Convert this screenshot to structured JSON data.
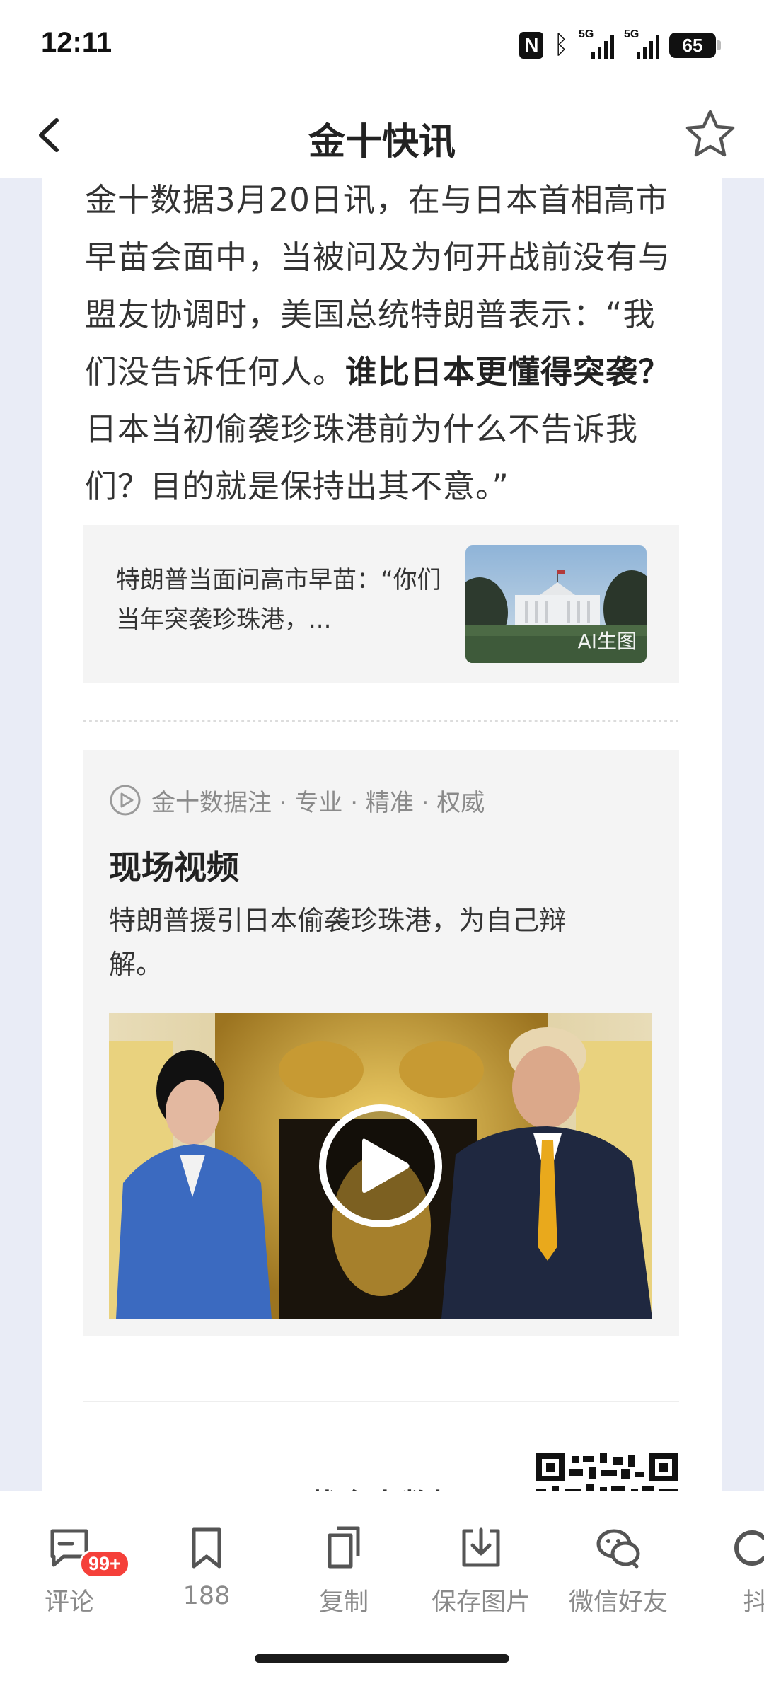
{
  "status_bar": {
    "time": "12:11",
    "network_1": "5G",
    "network_2": "5G",
    "battery": "65"
  },
  "nav": {
    "title": "金十快讯"
  },
  "article": {
    "para_1": "金十数据3月20日讯，在与日本首相高市早苗会面中，当被问及为何开战前没有与盟友协调时，美国总统特朗普表示：“我们没告诉任何人。",
    "para_bold": "谁比日本更懂得突袭？",
    "para_2": "日本当初偷袭珍珠港前为什么不告诉我们？目的就是保持出其不意。”"
  },
  "related": {
    "title": "特朗普当面问高市早苗：“你们当年突袭珍珠港，...",
    "thumb_tag": "AI生图"
  },
  "video_card": {
    "source": "金十数据注 · 专业 · 精准 · 权威",
    "title": "现场视频",
    "desc": "特朗普援引日本偷袭珍珠港，为自己辩解。"
  },
  "footer_peek": {
    "text": "下载金十数据"
  },
  "toolbar": {
    "comment_label": "评论",
    "comment_badge": "99+",
    "bookmark_label": "188",
    "copy_label": "复制",
    "save_label": "保存图片",
    "wechat_label": "微信好友",
    "douyin_label": "抖"
  },
  "colors": {
    "accent_red": "#f5403a",
    "muted": "#8a8a8a",
    "text": "#333333"
  }
}
